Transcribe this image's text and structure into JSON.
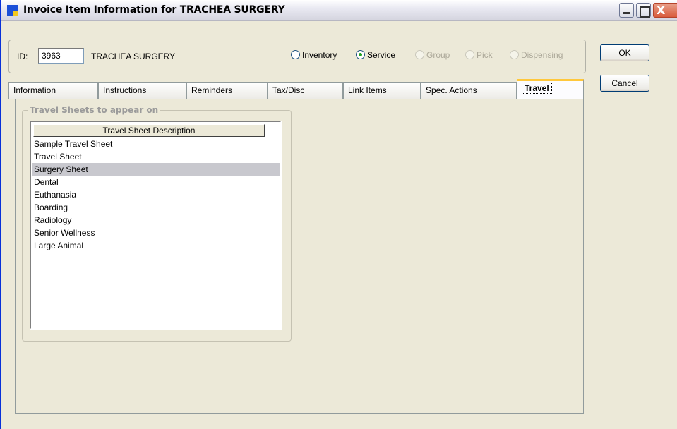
{
  "window": {
    "title": "Invoice Item Information for TRACHEA SURGERY",
    "close_glyph": "X"
  },
  "header": {
    "id_label": "ID:",
    "id_value": "3963",
    "item_name": "TRACHEA SURGERY"
  },
  "item_types": [
    {
      "label": "Inventory",
      "checked": false,
      "enabled": true
    },
    {
      "label": "Service",
      "checked": true,
      "enabled": true
    },
    {
      "label": "Group",
      "checked": false,
      "enabled": false
    },
    {
      "label": "Pick",
      "checked": false,
      "enabled": false
    },
    {
      "label": "Dispensing",
      "checked": false,
      "enabled": false
    }
  ],
  "buttons": {
    "ok": "OK",
    "cancel": "Cancel"
  },
  "tabs": [
    {
      "label": "Information",
      "active": false
    },
    {
      "label": "Instructions",
      "active": false
    },
    {
      "label": "Reminders",
      "active": false
    },
    {
      "label": "Tax/Disc",
      "active": false
    },
    {
      "label": "Link Items",
      "active": false
    },
    {
      "label": "Spec. Actions",
      "active": false
    },
    {
      "label": "Travel",
      "active": true
    }
  ],
  "travel": {
    "group_title": "Travel Sheets to appear on",
    "column_header": "Travel Sheet Description",
    "items": [
      {
        "label": "Sample Travel Sheet",
        "selected": false
      },
      {
        "label": "Travel Sheet",
        "selected": false
      },
      {
        "label": "Surgery Sheet",
        "selected": true
      },
      {
        "label": "Dental",
        "selected": false
      },
      {
        "label": "Euthanasia",
        "selected": false
      },
      {
        "label": "Boarding",
        "selected": false
      },
      {
        "label": "Radiology",
        "selected": false
      },
      {
        "label": "Senior Wellness",
        "selected": false
      },
      {
        "label": "Large Animal",
        "selected": false
      }
    ]
  },
  "colors": {
    "window_bg": "#ECE9D8",
    "active_tab_accent": "#FFC83C",
    "selection": "#C8C8CE",
    "radio_checked": "#21A121"
  }
}
